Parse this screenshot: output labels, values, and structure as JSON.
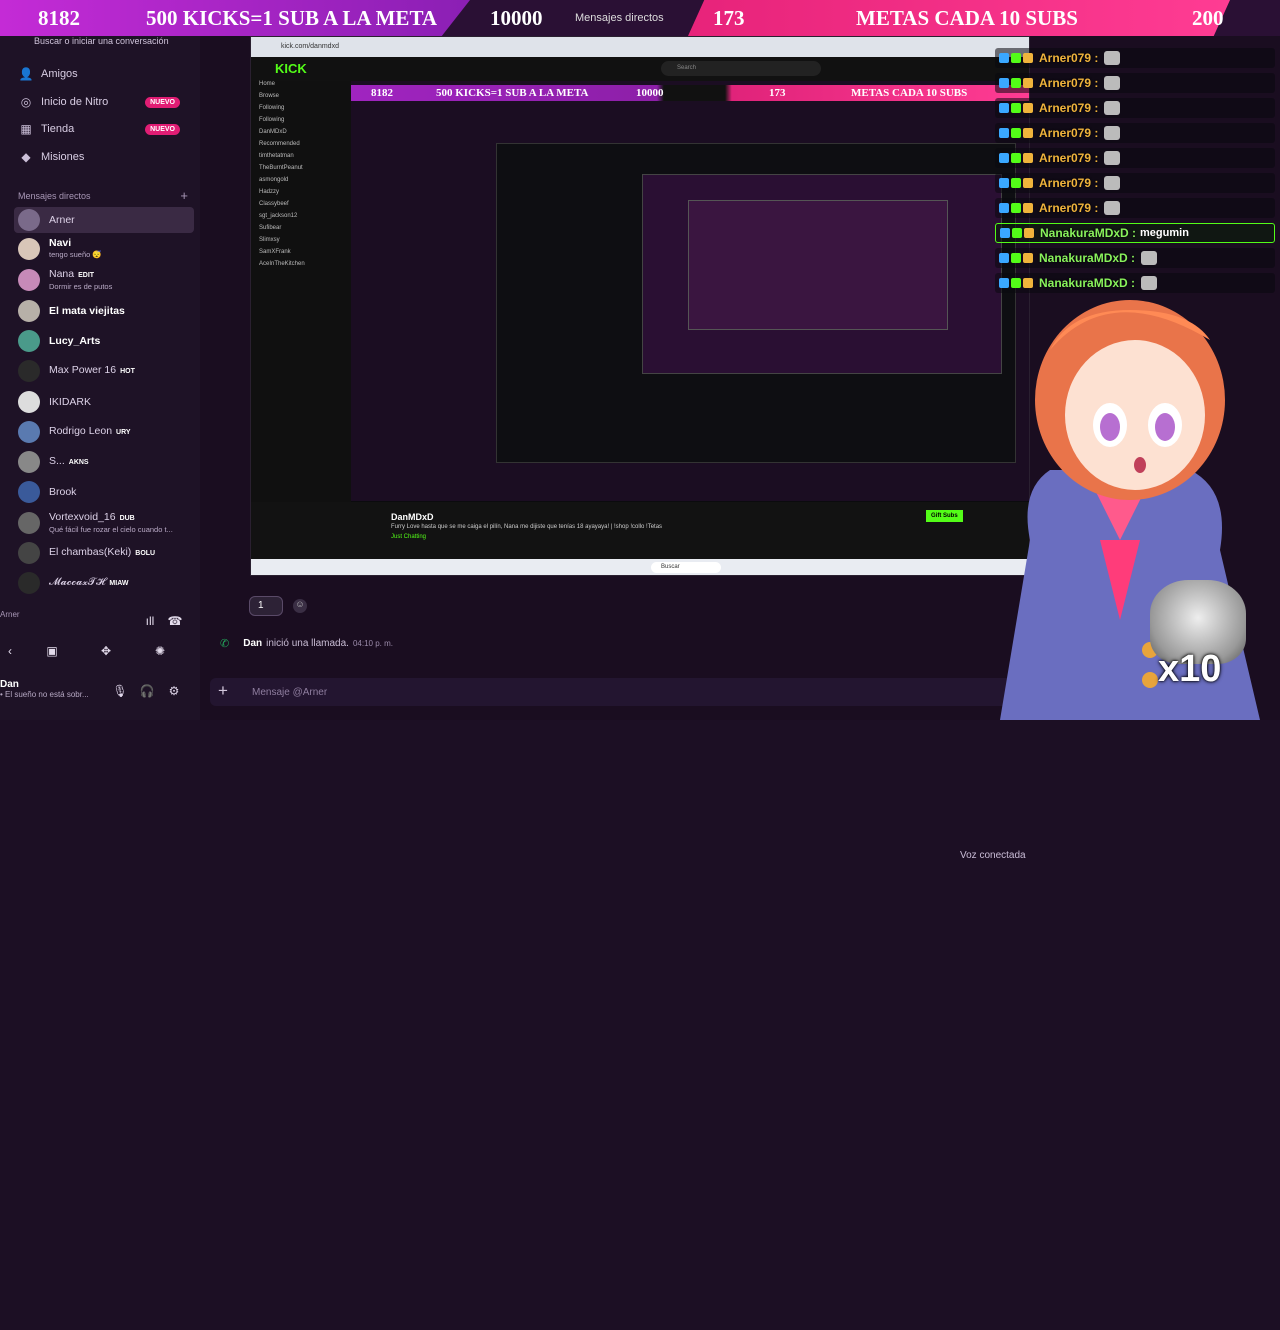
{
  "goal_bar": {
    "kicks_count": "8182",
    "kicks_goal_text": "500 KICKS=1 SUB A LA META",
    "kicks_target": "10000",
    "subs_count": "173",
    "subs_goal_text": "METAS CADA 10 SUBS",
    "subs_target": "200",
    "window_tab": "Mensajes directos"
  },
  "sidebar": {
    "search_hint": "Buscar o iniciar una conversación",
    "nav": [
      {
        "label": "Amigos",
        "icon": "friends-icon"
      },
      {
        "label": "Inicio de Nitro",
        "badge": "NUEVO",
        "icon": "nitro-icon"
      },
      {
        "label": "Tienda",
        "badge": "NUEVO",
        "icon": "shop-icon"
      },
      {
        "label": "Misiones",
        "icon": "quests-icon"
      }
    ],
    "dm_header": "Mensajes directos",
    "dms": [
      {
        "name": "Arner",
        "status": ""
      },
      {
        "name": "Navi",
        "status": "tengo sueño 😴"
      },
      {
        "name": "Nana",
        "tag": "EDIT",
        "status": "Dormir es de putos"
      },
      {
        "name": "El mata viejitas",
        "status": ""
      },
      {
        "name": "Lucy_Arts",
        "status": ""
      },
      {
        "name": "Max Power 16",
        "tag": "HOT",
        "status": ""
      },
      {
        "name": "IKIDARK",
        "status": ""
      },
      {
        "name": "Rodrigo Leon",
        "tag": "URY",
        "status": ""
      },
      {
        "name": "S...",
        "tag": "AKNS",
        "status": ""
      },
      {
        "name": "Brook",
        "status": ""
      },
      {
        "name": "Vortexvoid_16",
        "tag": "DUB",
        "status": "Qué fácil fue rozar el cielo cuando t..."
      },
      {
        "name": "El chambas(Keki)",
        "tag": "BOLU",
        "status": ""
      },
      {
        "name": "𝓜𝓪𝓬𝓬𝓪𝔁𝓣𝓗",
        "tag": "MIAW",
        "status": ""
      }
    ],
    "voice_title": "Voz conectada",
    "voice_sub": "Arner",
    "user_name": "Dan",
    "user_status": "• El sueño no está sobr..."
  },
  "main": {
    "reaction_count": "1",
    "call_user": "Dan",
    "call_text": "inició una llamada.",
    "call_time": "04:10 p. m.",
    "message_placeholder": "Mensaje @Arner"
  },
  "stream": {
    "browser_url": "kick.com/danmdxd",
    "kick_logo": "KICK",
    "kick_search": "Search",
    "kick_nav": [
      "Home",
      "Browse",
      "Following",
      "Following",
      "DanMDxD",
      "Recommended",
      "timthetatman",
      "TheBurntPeanut",
      "asmongold",
      "Hadzzy",
      "Classybeef",
      "sgt_jackson12",
      "Sufibear",
      "Slimxsy",
      "SamXFrank",
      "AceInTheKitchen"
    ],
    "streamer_name": "DanMDxD",
    "stream_title": "Furry Love hasta que se me caiga el pilín, Nana me dijiste que tenías 18 ayayaya! | !shop !collo !Tetas",
    "stream_category": "Just Chatting",
    "gift_label": "Gift Subs",
    "taskbar_search": "Buscar"
  },
  "chat_overlay": [
    {
      "user": "Arner079 :",
      "msg": "",
      "color": "#f0b43c"
    },
    {
      "user": "Arner079 :",
      "msg": "",
      "color": "#f0b43c"
    },
    {
      "user": "Arner079 :",
      "msg": "",
      "color": "#f0b43c"
    },
    {
      "user": "Arner079 :",
      "msg": "",
      "color": "#f0b43c"
    },
    {
      "user": "Arner079 :",
      "msg": "",
      "color": "#f0b43c"
    },
    {
      "user": "Arner079 :",
      "msg": "",
      "color": "#f0b43c"
    },
    {
      "user": "Arner079 :",
      "msg": "",
      "color": "#f0b43c"
    },
    {
      "user": "NanakuraMDxD :",
      "msg": "megumin",
      "color": "#89f25c"
    },
    {
      "user": "NanakuraMDxD :",
      "msg": "",
      "color": "#89f25c"
    },
    {
      "user": "NanakuraMDxD :",
      "msg": "",
      "color": "#89f25c"
    }
  ],
  "overlay_emote": {
    "label": "x10"
  },
  "colors": {
    "kick_green": "#53fc18",
    "goal_pink": "#e7237a",
    "goal_purple": "#c42bd6",
    "nuevo_badge": "#e11d74"
  }
}
